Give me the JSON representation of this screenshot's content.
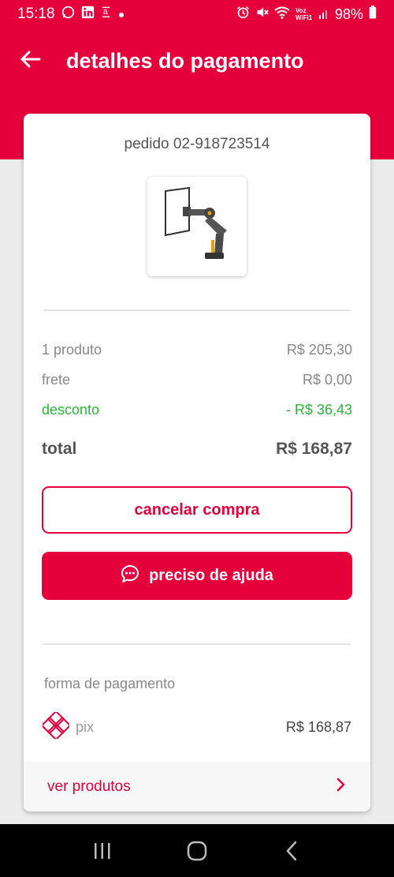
{
  "status_bar": {
    "time": "15:18",
    "battery": "98%",
    "network_label": "Voz WiFi1"
  },
  "header": {
    "title": "detalhes do pagamento"
  },
  "order": {
    "label": "pedido 02-918723514"
  },
  "summary": {
    "products_label": "1 produto",
    "products_value": "R$ 205,30",
    "shipping_label": "frete",
    "shipping_value": "R$ 0,00",
    "discount_label": "desconto",
    "discount_value": "- R$ 36,43",
    "total_label": "total",
    "total_value": "R$ 168,87"
  },
  "actions": {
    "cancel_label": "cancelar compra",
    "help_label": "preciso de ajuda"
  },
  "payment": {
    "section_label": "forma de pagamento",
    "method": "pix",
    "amount": "R$ 168,87"
  },
  "footer": {
    "view_products_label": "ver produtos"
  },
  "colors": {
    "brand": "#e6003b",
    "discount": "#2bb53c"
  },
  "icons": [
    "whatsapp-icon",
    "linkedin-icon",
    "alarm-icon",
    "mute-icon",
    "wifi-icon",
    "signal-icon",
    "battery-icon",
    "back-arrow-icon",
    "chat-icon",
    "pix-icon",
    "chevron-right-icon",
    "recents-icon",
    "home-icon",
    "nav-back-icon"
  ]
}
